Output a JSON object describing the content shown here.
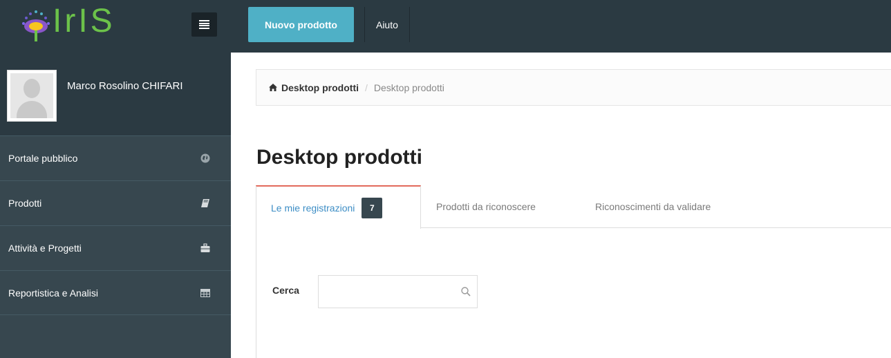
{
  "topbar": {
    "logo_text": "IrIS",
    "new_product_label": "Nuovo prodotto",
    "help_label": "Aiuto"
  },
  "sidebar": {
    "user_name": "Marco Rosolino CHIFARI",
    "items": [
      {
        "label": "Portale pubblico",
        "icon": "globe-icon"
      },
      {
        "label": "Prodotti",
        "icon": "book-icon"
      },
      {
        "label": "Attività e Progetti",
        "icon": "briefcase-icon"
      },
      {
        "label": "Reportistica e Analisi",
        "icon": "table-icon"
      }
    ]
  },
  "breadcrumb": {
    "home": "Desktop prodotti",
    "separator": "/",
    "current": "Desktop prodotti"
  },
  "page": {
    "title": "Desktop prodotti"
  },
  "tabs": [
    {
      "label": "Le mie registrazioni",
      "badge": "7",
      "active": true
    },
    {
      "label": "Prodotti da riconoscere"
    },
    {
      "label": "Riconoscimenti da validare"
    }
  ],
  "search": {
    "label": "Cerca",
    "value": "",
    "placeholder": ""
  },
  "colors": {
    "topbar": "#2b3a42",
    "sidebar": "#37474f",
    "accent": "#4fb0c6",
    "active_tab_border": "#e26a5b",
    "link": "#3c8dc5"
  }
}
